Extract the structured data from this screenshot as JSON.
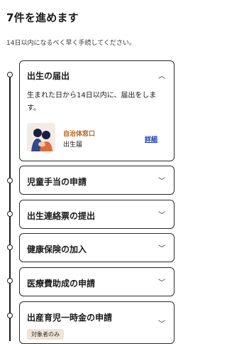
{
  "header": {
    "title": "7件を進めます",
    "subtitle": "14日以内になるべく早く手続してください。"
  },
  "steps": [
    {
      "title": "出生の届出",
      "expanded": true,
      "description": "生まれた日から14日以内に、届出をします。",
      "location": "自治体窓口",
      "form": "出生届",
      "detail_link": "詳細",
      "chevron_icon": "chevron-up-icon"
    },
    {
      "title": "児童手当の申請",
      "chevron_icon": "chevron-down-icon"
    },
    {
      "title": "出生連絡票の提出",
      "chevron_icon": "chevron-down-icon"
    },
    {
      "title": "健康保険の加入",
      "chevron_icon": "chevron-down-icon"
    },
    {
      "title": "医療費助成の申請",
      "chevron_icon": "chevron-down-icon"
    },
    {
      "title": "出産育児一時金の申請",
      "badge": "対象者のみ",
      "chevron_icon": "chevron-down-icon"
    }
  ],
  "colors": {
    "accent_orange": "#b8621b",
    "link_blue": "#1f3bb3",
    "badge_bg": "#efe4d6"
  }
}
